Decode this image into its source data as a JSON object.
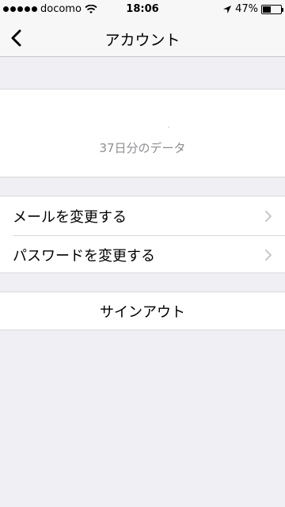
{
  "status_bar": {
    "carrier": "docomo",
    "time": "18:06",
    "battery_percent": "47%",
    "battery_level": 0.47,
    "icons": [
      "signal-dots-icon",
      "wifi-icon",
      "location-arrow-icon",
      "battery-icon"
    ]
  },
  "nav": {
    "title": "アカウント",
    "back_icon": "chevron-left-icon"
  },
  "data_section": {
    "label": "37日分のデータ"
  },
  "menu": {
    "items": [
      {
        "label": "メールを変更する",
        "icon": "chevron-right-icon"
      },
      {
        "label": "パスワードを変更する",
        "icon": "chevron-right-icon"
      }
    ]
  },
  "signout": {
    "label": "サインアウト"
  },
  "colors": {
    "background": "#efeff4",
    "cell": "#ffffff",
    "secondary_text": "#8e8e93",
    "chevron": "#c7c7cc"
  }
}
